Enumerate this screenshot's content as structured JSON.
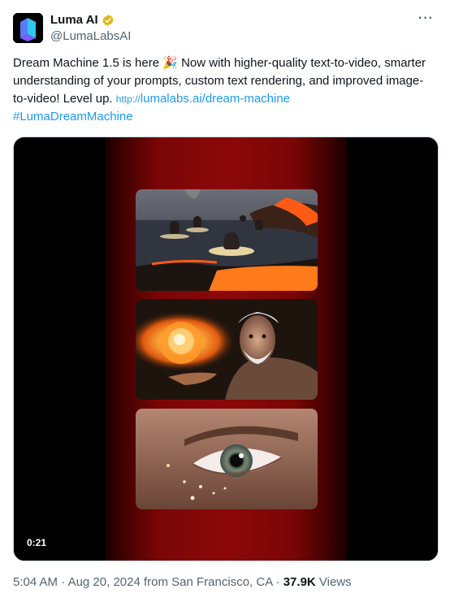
{
  "author": {
    "name": "Luma AI",
    "handle": "@LumaLabsAI",
    "verified_color": "#e2b719"
  },
  "menu": {
    "more_icon": "more-horizontal-icon",
    "more_label": "···"
  },
  "tweet": {
    "text_main": "Dream Machine 1.5 is here 🎉 Now with higher-quality text-to-video, smarter understanding of your prompts, custom text rendering, and improved image-to-video! Level up.",
    "link_prefix": "http://",
    "link_text": "lumalabs.ai/dream-machine",
    "hashtag": "#LumaDreamMachine"
  },
  "media": {
    "duration": "0:21",
    "frames": [
      "cats-surfing-lava",
      "old-man-fireball",
      "eye-close-up"
    ]
  },
  "meta": {
    "time": "5:04 AM",
    "date": "Aug 20, 2024",
    "location_prefix": "from",
    "location": "San Francisco, CA",
    "views_count": "37.9K",
    "views_label": "Views"
  },
  "colors": {
    "link": "#1d9bf0",
    "secondary": "#536471",
    "primary": "#0f1419"
  }
}
